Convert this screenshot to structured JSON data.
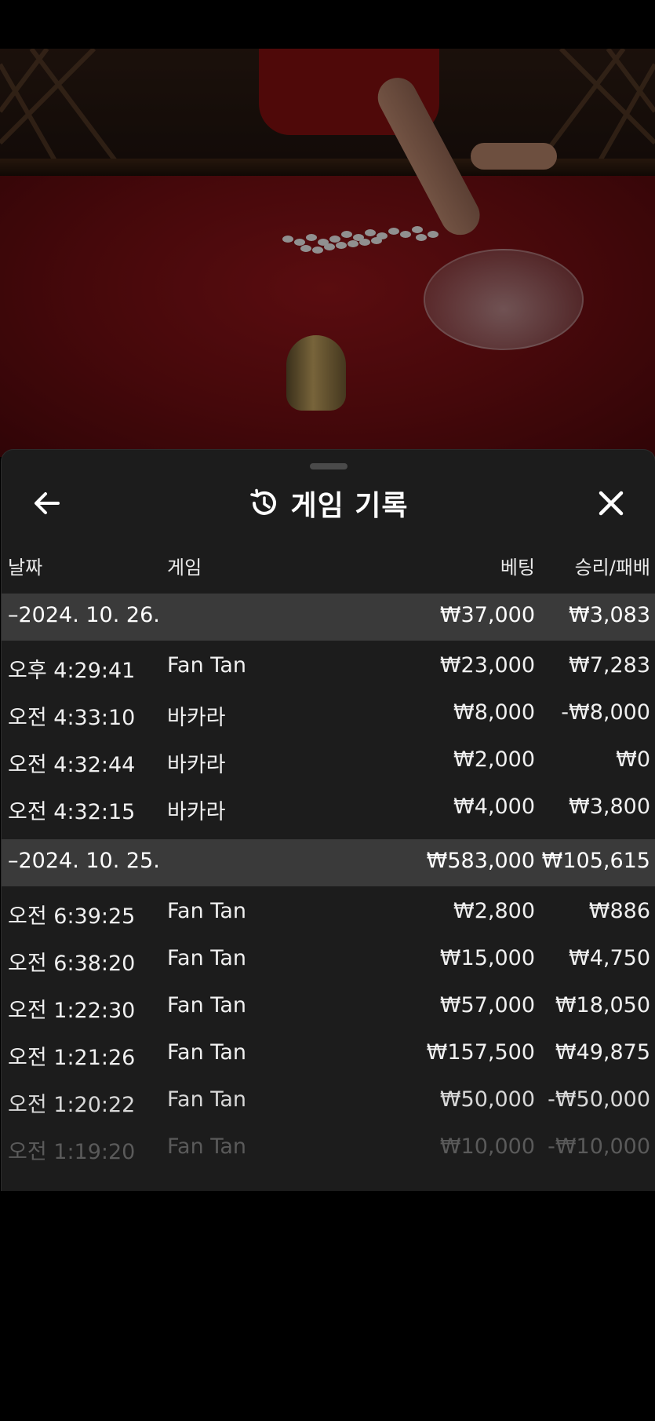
{
  "sheet": {
    "title": "게임 기록",
    "columns": {
      "date": "날짜",
      "game": "게임",
      "bet": "베팅",
      "win_loss": "승리/패배"
    }
  },
  "groups": [
    {
      "date": "–2024. 10. 26.",
      "bet_total": "₩37,000",
      "wl_total": "₩3,083",
      "rows": [
        {
          "time": "오후 4:29:41",
          "game": "Fan Tan",
          "bet": "₩23,000",
          "wl": "₩7,283"
        },
        {
          "time": "오전 4:33:10",
          "game": "바카라",
          "bet": "₩8,000",
          "wl": "-₩8,000"
        },
        {
          "time": "오전 4:32:44",
          "game": "바카라",
          "bet": "₩2,000",
          "wl": "₩0"
        },
        {
          "time": "오전 4:32:15",
          "game": "바카라",
          "bet": "₩4,000",
          "wl": "₩3,800"
        }
      ]
    },
    {
      "date": "–2024. 10. 25.",
      "bet_total": "₩583,000",
      "wl_total": "₩105,615",
      "rows": [
        {
          "time": "오전 6:39:25",
          "game": "Fan Tan",
          "bet": "₩2,800",
          "wl": "₩886"
        },
        {
          "time": "오전 6:38:20",
          "game": "Fan Tan",
          "bet": "₩15,000",
          "wl": "₩4,750"
        },
        {
          "time": "오전 1:22:30",
          "game": "Fan Tan",
          "bet": "₩57,000",
          "wl": "₩18,050"
        },
        {
          "time": "오전 1:21:26",
          "game": "Fan Tan",
          "bet": "₩157,500",
          "wl": "₩49,875"
        },
        {
          "time": "오전 1:20:22",
          "game": "Fan Tan",
          "bet": "₩50,000",
          "wl": "-₩50,000"
        },
        {
          "time": "오전 1:19:20",
          "game": "Fan Tan",
          "bet": "₩10,000",
          "wl": "-₩10,000"
        }
      ]
    }
  ],
  "icons": {
    "back": "arrow-left-icon",
    "history": "history-icon",
    "close": "close-icon"
  },
  "colors": {
    "sheet_bg": "#1c1c1c",
    "group_bg": "#3a3a3a",
    "text": "#ffffff"
  }
}
